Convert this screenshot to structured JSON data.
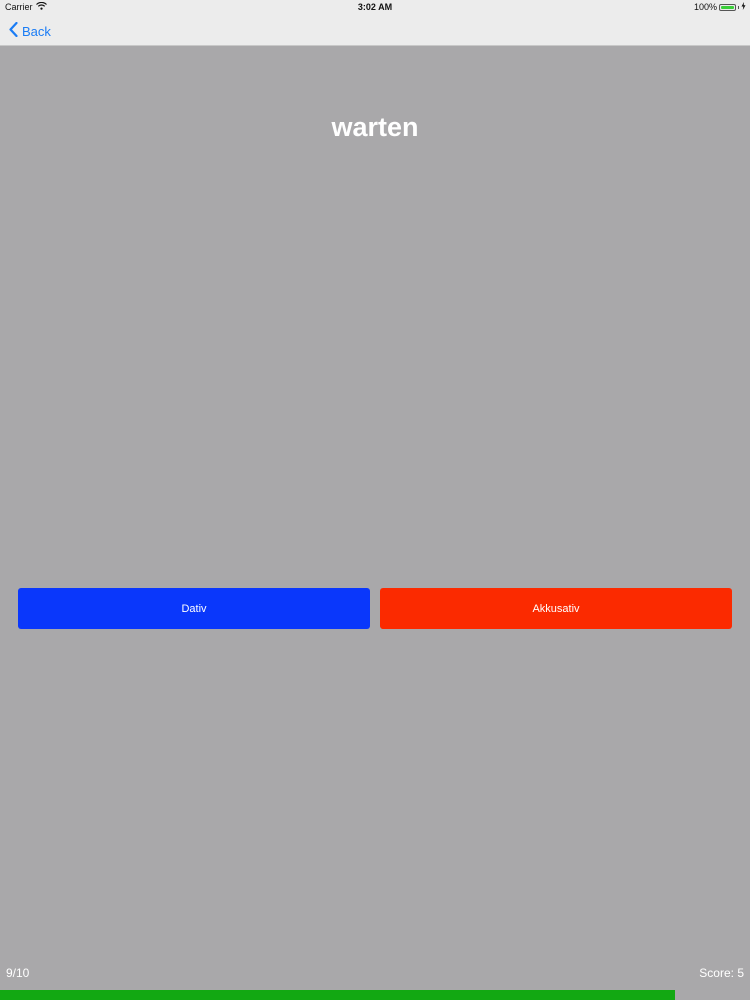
{
  "status_bar": {
    "carrier": "Carrier",
    "time": "3:02 AM",
    "battery": "100%",
    "icons": [
      "wifi-icon",
      "battery-icon",
      "charging-icon"
    ]
  },
  "nav": {
    "back_label": "Back",
    "back_icon": "chevron-left-icon",
    "accent_color": "#1a7cf5"
  },
  "quiz": {
    "word": "warten",
    "options": [
      {
        "label": "Dativ",
        "color": "#0a37fb"
      },
      {
        "label": "Akkusativ",
        "color": "#fb2a00"
      }
    ]
  },
  "footer": {
    "progress_text": "9/10",
    "score_text": "Score: 5",
    "progress_fraction": 0.9,
    "progress_color": "#12a812"
  }
}
